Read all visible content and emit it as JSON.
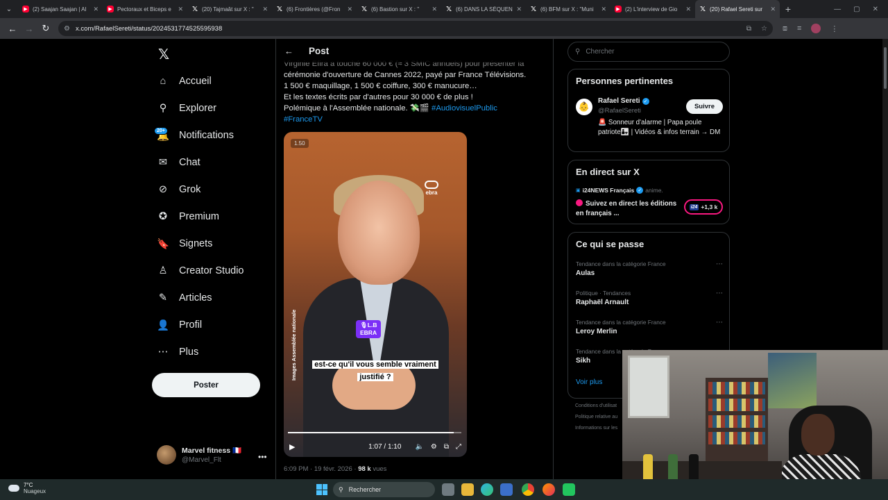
{
  "browser": {
    "tabs": [
      {
        "title": "(2) Saajan Saajan | Al",
        "icon": "youtube"
      },
      {
        "title": "Pectoraux et Biceps e",
        "icon": "youtube"
      },
      {
        "title": "(20) Tajmaât sur X : \"",
        "icon": "x"
      },
      {
        "title": "(6) Frontières (@Fron",
        "icon": "x"
      },
      {
        "title": "(6) Bastion sur X : \"",
        "icon": "x"
      },
      {
        "title": "(6) DANS LA SÉQUEN",
        "icon": "x"
      },
      {
        "title": "(6) BFM sur X : \"Muni",
        "icon": "x"
      },
      {
        "title": "(2) L'interview de Gio",
        "icon": "youtube"
      },
      {
        "title": "(20) Rafael Sereti sur",
        "icon": "x",
        "active": true
      }
    ],
    "url": "x.com/RafaelSereti/status/2024531774525595938"
  },
  "leftnav": {
    "items": [
      {
        "label": "Accueil",
        "icon": "home-icon"
      },
      {
        "label": "Explorer",
        "icon": "search-icon"
      },
      {
        "label": "Notifications",
        "icon": "bell-icon",
        "badge": "20+"
      },
      {
        "label": "Chat",
        "icon": "mail-icon"
      },
      {
        "label": "Grok",
        "icon": "grok-icon"
      },
      {
        "label": "Premium",
        "icon": "premium-icon"
      },
      {
        "label": "Signets",
        "icon": "bookmark-icon"
      },
      {
        "label": "Creator Studio",
        "icon": "creator-icon"
      },
      {
        "label": "Articles",
        "icon": "articles-icon"
      },
      {
        "label": "Profil",
        "icon": "profile-icon"
      },
      {
        "label": "Plus",
        "icon": "more-icon"
      }
    ],
    "post_button": "Poster",
    "account": {
      "name": "Marvel fitness 🇫🇷",
      "handle": "@Marvel_Flt"
    }
  },
  "post": {
    "header_title": "Post",
    "text_lines": [
      "Virginie Efira a touché 60 000 € (≈ 3 SMIC annuels) pour présenter la",
      "cérémonie d'ouverture de Cannes 2022, payé par France Télévisions.",
      "1 500 € maquillage, 1 500 € coiffure, 300 € manucure…",
      "Et les textes écrits par d'autres pour 30 000 € de plus !",
      "Polémique à l'Assemblée nationale. 💸🎬"
    ],
    "hashtag1": "#AudiovisuelPublic",
    "hashtag2": "#FranceTV",
    "video": {
      "badge": "1.50",
      "logo_text": "ebra",
      "watermark": "Images Assemblée nationale",
      "name_tag_line1": "🎙L.B",
      "name_tag_line2": "EBRA",
      "caption_line1": "est-ce qu'il vous semble vraiment",
      "caption_line2": "justifié ?",
      "time": "1:07 / 1:10",
      "progress": 0.957
    },
    "meta_time": "6:09 PM · 19 févr. 2026 · ",
    "meta_views": "98 k",
    "meta_views_label": " vues"
  },
  "right": {
    "search_placeholder": "Chercher",
    "relevant": {
      "title": "Personnes pertinentes",
      "name": "Rafael Sereti",
      "handle": "@RafaelSereti",
      "follow": "Suivre",
      "bio": "🚨 Sonneur d'alarme | Papa poule patriote👨‍👧 | Vidéos & infos terrain → DM"
    },
    "live": {
      "title": "En direct sur X",
      "source": "i24NEWS Français",
      "source_suffix": "anime.",
      "headline": "Suivez en direct les éditions en français ...",
      "pill_logo": "i24",
      "pill_count": "+1,3 k"
    },
    "trends": {
      "title": "Ce qui se passe",
      "items": [
        {
          "category": "Tendance dans la catégorie France",
          "name": "Aulas"
        },
        {
          "category": "Politique · Tendances",
          "name": "Raphaël Arnault"
        },
        {
          "category": "Tendance dans la catégorie France",
          "name": "Leroy Merlin"
        },
        {
          "category": "Tendance dans la catégorie France",
          "name": "Sikh"
        }
      ],
      "show_more": "Voir plus"
    },
    "footer": [
      "Conditions d'utilisat",
      "Politique relative au",
      "Informations sur les"
    ]
  },
  "taskbar": {
    "temp": "7°C",
    "weather": "Nuageux",
    "search": "Rechercher"
  }
}
